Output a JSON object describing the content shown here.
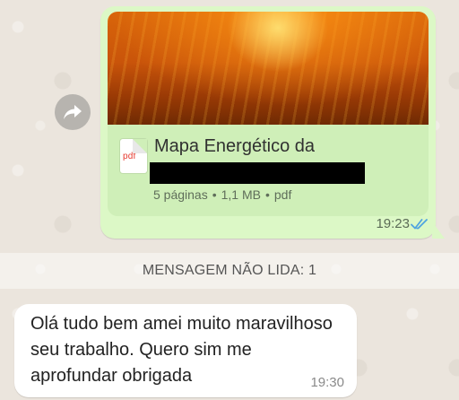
{
  "messages": {
    "outgoing_document": {
      "file_type_badge": "pdf",
      "file_name": "Mapa Energético da",
      "pages": "5 páginas",
      "size": "1,1 MB",
      "format": "pdf",
      "separator": "•",
      "time": "19:23",
      "status_icon": "double-check-read-icon",
      "status_color": "#4fa3e0",
      "preview_colors": [
        "#d9650a",
        "#ffb43a",
        "#6f2a03"
      ]
    },
    "unread_divider": {
      "label": "MENSAGEM NÃO LIDA: 1"
    },
    "incoming_text": {
      "text": "Olá tudo bem amei muito maravilhoso seu trabalho. Quero sim me aprofundar obrigada",
      "time": "19:30"
    }
  },
  "actions": {
    "forward_icon": "forward-arrow-icon"
  },
  "colors": {
    "outgoing_bubble": "#dcf8c6",
    "incoming_bubble": "#ffffff",
    "chat_background": "#ebe5dd"
  }
}
